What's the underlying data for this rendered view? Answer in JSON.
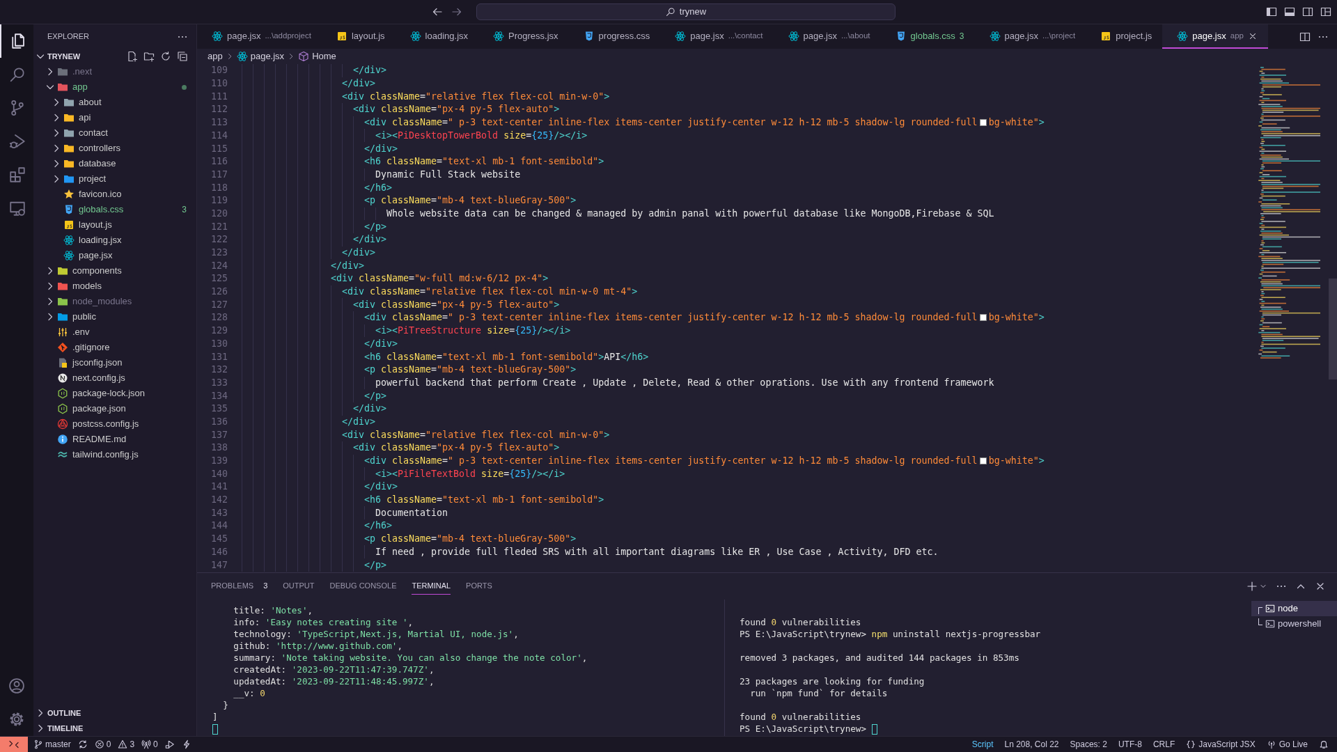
{
  "title_bar": {
    "search": "trynew"
  },
  "activity_bar": [
    {
      "kind": "files",
      "selected": true
    },
    {
      "kind": "search",
      "selected": false
    },
    {
      "kind": "source-control",
      "selected": false
    },
    {
      "kind": "run-debug",
      "selected": false
    },
    {
      "kind": "extensions",
      "selected": false
    },
    {
      "kind": "remote-explorer",
      "selected": false
    }
  ],
  "activity_bar_bottom": [
    {
      "kind": "account"
    },
    {
      "kind": "settings"
    }
  ],
  "sidebar": {
    "title": "EXPLORER",
    "root": {
      "label": "TRYNEW",
      "expanded": true
    },
    "tree": [
      {
        "label": ".next",
        "kind": "folder-next",
        "expanded": false,
        "modified": false,
        "ignored": true
      },
      {
        "label": "app",
        "kind": "folder-app",
        "expanded": true,
        "modified": true,
        "ignored": false,
        "children": [
          {
            "label": "about",
            "kind": "folder",
            "expanded": false,
            "modified": false,
            "ignored": false
          },
          {
            "label": "api",
            "kind": "folder-api",
            "expanded": false,
            "modified": false,
            "ignored": false
          },
          {
            "label": "contact",
            "kind": "folder",
            "expanded": false,
            "modified": false,
            "ignored": false
          },
          {
            "label": "controllers",
            "kind": "folder-controllers",
            "expanded": false,
            "modified": false,
            "ignored": false
          },
          {
            "label": "database",
            "kind": "folder-database",
            "expanded": false,
            "modified": false,
            "ignored": false
          },
          {
            "label": "project",
            "kind": "folder-project",
            "expanded": false,
            "modified": false,
            "ignored": false
          },
          {
            "label": "favicon.ico",
            "kind": "star",
            "modified": false,
            "ignored": false
          },
          {
            "label": "globals.css",
            "kind": "css",
            "modified": true,
            "ignored": false,
            "badge": "3"
          },
          {
            "label": "layout.js",
            "kind": "js",
            "modified": false,
            "ignored": false
          },
          {
            "label": "loading.jsx",
            "kind": "react",
            "modified": false,
            "ignored": false
          },
          {
            "label": "page.jsx",
            "kind": "react",
            "modified": false,
            "ignored": false
          }
        ]
      },
      {
        "label": "components",
        "kind": "folder-components",
        "expanded": false,
        "modified": false,
        "ignored": false
      },
      {
        "label": "models",
        "kind": "folder-models",
        "expanded": false,
        "modified": false,
        "ignored": false
      },
      {
        "label": "node_modules",
        "kind": "folder-node",
        "expanded": false,
        "modified": false,
        "ignored": true
      },
      {
        "label": "public",
        "kind": "folder-public",
        "expanded": false,
        "modified": false,
        "ignored": false
      },
      {
        "label": ".env",
        "kind": "env",
        "modified": false,
        "ignored": false
      },
      {
        "label": ".gitignore",
        "kind": "git",
        "modified": false,
        "ignored": false
      },
      {
        "label": "jsconfig.json",
        "kind": "jsconfig",
        "modified": false,
        "ignored": false
      },
      {
        "label": "next.config.js",
        "kind": "next",
        "modified": false,
        "ignored": false
      },
      {
        "label": "package-lock.json",
        "kind": "nodejs",
        "modified": false,
        "ignored": false
      },
      {
        "label": "package.json",
        "kind": "nodejs",
        "modified": false,
        "ignored": false
      },
      {
        "label": "postcss.config.js",
        "kind": "postcss",
        "modified": false,
        "ignored": false
      },
      {
        "label": "README.md",
        "kind": "info",
        "modified": false,
        "ignored": false
      },
      {
        "label": "tailwind.config.js",
        "kind": "tailwind",
        "modified": false,
        "ignored": false
      }
    ],
    "sections": [
      {
        "label": "OUTLINE",
        "expanded": false
      },
      {
        "label": "TIMELINE",
        "expanded": false
      }
    ]
  },
  "tabs": [
    {
      "label": "page.jsx",
      "description": "...\\addproject",
      "kind": "react",
      "selected": false,
      "modified": false
    },
    {
      "label": "layout.js",
      "kind": "js",
      "selected": false,
      "modified": false
    },
    {
      "label": "loading.jsx",
      "kind": "react",
      "selected": false,
      "modified": false
    },
    {
      "label": "Progress.jsx",
      "kind": "react",
      "selected": false,
      "modified": false
    },
    {
      "label": "progress.css",
      "kind": "css",
      "selected": false,
      "modified": false
    },
    {
      "label": "page.jsx",
      "description": "...\\contact",
      "kind": "react",
      "selected": false,
      "modified": false
    },
    {
      "label": "page.jsx",
      "description": "...\\about",
      "kind": "react",
      "selected": false,
      "modified": false
    },
    {
      "label": "globals.css",
      "kind": "css",
      "selected": false,
      "modified": true,
      "badge": "3"
    },
    {
      "label": "page.jsx",
      "description": "...\\project",
      "kind": "react",
      "selected": false,
      "modified": false
    },
    {
      "label": "project.js",
      "kind": "js",
      "selected": false,
      "modified": false
    },
    {
      "label": "page.jsx",
      "description": "app",
      "kind": "react",
      "selected": true,
      "modified": false
    }
  ],
  "breadcrumbs": [
    {
      "label": "app"
    },
    {
      "label": "page.jsx",
      "kind": "react"
    },
    {
      "label": "Home",
      "kind": "symbol"
    }
  ],
  "editor": {
    "lines": [
      {
        "number": "109",
        "tokens": [
          {
            "kind": "tag",
            "text": "                    </div>"
          }
        ]
      },
      {
        "number": "110",
        "tokens": [
          {
            "kind": "tag",
            "text": "                  </div>"
          }
        ]
      },
      {
        "number": "111",
        "tokens": [
          {
            "kind": "tag",
            "text": "                  <div"
          },
          {
            "kind": "attr",
            "text": " className"
          },
          {
            "kind": "op",
            "text": "="
          },
          {
            "kind": "str",
            "text": "\"relative flex flex-col min-w-0\""
          },
          {
            "kind": "tag",
            "text": ">"
          }
        ]
      },
      {
        "number": "112",
        "tokens": [
          {
            "kind": "tag",
            "text": "                    <div"
          },
          {
            "kind": "attr",
            "text": " className"
          },
          {
            "kind": "op",
            "text": "="
          },
          {
            "kind": "str",
            "text": "\"px-4 py-5 flex-auto\""
          },
          {
            "kind": "tag",
            "text": ">"
          }
        ]
      },
      {
        "number": "113",
        "tokens": [
          {
            "kind": "tag",
            "text": "                      <div"
          },
          {
            "kind": "attr",
            "text": " className"
          },
          {
            "kind": "op",
            "text": "="
          },
          {
            "kind": "str",
            "text": "\" p-3 text-center inline-flex items-center justify-center w-12 h-12 mb-5 shadow-lg rounded-full"
          },
          {
            "kind": "swatch",
            "color": "#ffffff"
          },
          {
            "kind": "str",
            "text": "bg-white\""
          },
          {
            "kind": "tag",
            "text": ">"
          }
        ]
      },
      {
        "number": "114",
        "tokens": [
          {
            "kind": "tag",
            "text": "                        <i><"
          },
          {
            "kind": "comp",
            "text": "PiDesktopTowerBold"
          },
          {
            "kind": "attr",
            "text": " size"
          },
          {
            "kind": "op",
            "text": "="
          },
          {
            "kind": "num",
            "text": "{25}"
          },
          {
            "kind": "tag",
            "text": "/></i>"
          }
        ]
      },
      {
        "number": "115",
        "tokens": [
          {
            "kind": "tag",
            "text": "                      </div>"
          }
        ]
      },
      {
        "number": "116",
        "tokens": [
          {
            "kind": "tag",
            "text": "                      <h6"
          },
          {
            "kind": "attr",
            "text": " className"
          },
          {
            "kind": "op",
            "text": "="
          },
          {
            "kind": "str",
            "text": "\"text-xl mb-1 font-semibold\""
          },
          {
            "kind": "tag",
            "text": ">"
          }
        ]
      },
      {
        "number": "117",
        "tokens": [
          {
            "kind": "txt",
            "text": "                        Dynamic Full Stack website"
          }
        ]
      },
      {
        "number": "118",
        "tokens": [
          {
            "kind": "tag",
            "text": "                      </h6>"
          }
        ]
      },
      {
        "number": "119",
        "tokens": [
          {
            "kind": "tag",
            "text": "                      <p"
          },
          {
            "kind": "attr",
            "text": " className"
          },
          {
            "kind": "op",
            "text": "="
          },
          {
            "kind": "str",
            "text": "\"mb-4 text-blueGray-500\""
          },
          {
            "kind": "tag",
            "text": ">"
          }
        ]
      },
      {
        "number": "120",
        "tokens": [
          {
            "kind": "txt",
            "text": "                          Whole website data can be changed & managed by admin panal with powerful database like MongoDB,Firebase & SQL"
          }
        ]
      },
      {
        "number": "121",
        "tokens": [
          {
            "kind": "tag",
            "text": "                      </p>"
          }
        ]
      },
      {
        "number": "122",
        "tokens": [
          {
            "kind": "tag",
            "text": "                    </div>"
          }
        ]
      },
      {
        "number": "123",
        "tokens": [
          {
            "kind": "tag",
            "text": "                  </div>"
          }
        ]
      },
      {
        "number": "124",
        "tokens": [
          {
            "kind": "tag",
            "text": "                </div>"
          }
        ]
      },
      {
        "number": "125",
        "tokens": [
          {
            "kind": "tag",
            "text": "                <div"
          },
          {
            "kind": "attr",
            "text": " className"
          },
          {
            "kind": "op",
            "text": "="
          },
          {
            "kind": "str",
            "text": "\"w-full md:w-6/12 px-4\""
          },
          {
            "kind": "tag",
            "text": ">"
          }
        ]
      },
      {
        "number": "126",
        "tokens": [
          {
            "kind": "tag",
            "text": "                  <div"
          },
          {
            "kind": "attr",
            "text": " className"
          },
          {
            "kind": "op",
            "text": "="
          },
          {
            "kind": "str",
            "text": "\"relative flex flex-col min-w-0 mt-4\""
          },
          {
            "kind": "tag",
            "text": ">"
          }
        ]
      },
      {
        "number": "127",
        "tokens": [
          {
            "kind": "tag",
            "text": "                    <div"
          },
          {
            "kind": "attr",
            "text": " className"
          },
          {
            "kind": "op",
            "text": "="
          },
          {
            "kind": "str",
            "text": "\"px-4 py-5 flex-auto\""
          },
          {
            "kind": "tag",
            "text": ">"
          }
        ]
      },
      {
        "number": "128",
        "tokens": [
          {
            "kind": "tag",
            "text": "                      <div"
          },
          {
            "kind": "attr",
            "text": " className"
          },
          {
            "kind": "op",
            "text": "="
          },
          {
            "kind": "str",
            "text": "\" p-3 text-center inline-flex items-center justify-center w-12 h-12 mb-5 shadow-lg rounded-full"
          },
          {
            "kind": "swatch",
            "color": "#ffffff"
          },
          {
            "kind": "str",
            "text": "bg-white\""
          },
          {
            "kind": "tag",
            "text": ">"
          }
        ]
      },
      {
        "number": "129",
        "tokens": [
          {
            "kind": "tag",
            "text": "                        <i><"
          },
          {
            "kind": "comp",
            "text": "PiTreeStructure"
          },
          {
            "kind": "attr",
            "text": " size"
          },
          {
            "kind": "op",
            "text": "="
          },
          {
            "kind": "num",
            "text": "{25}"
          },
          {
            "kind": "tag",
            "text": "/></i>"
          }
        ]
      },
      {
        "number": "130",
        "tokens": [
          {
            "kind": "tag",
            "text": "                      </div>"
          }
        ]
      },
      {
        "number": "131",
        "tokens": [
          {
            "kind": "tag",
            "text": "                      <h6"
          },
          {
            "kind": "attr",
            "text": " className"
          },
          {
            "kind": "op",
            "text": "="
          },
          {
            "kind": "str",
            "text": "\"text-xl mb-1 font-semibold\""
          },
          {
            "kind": "tag",
            "text": ">"
          },
          {
            "kind": "txt",
            "text": "API"
          },
          {
            "kind": "tag",
            "text": "</h6>"
          }
        ]
      },
      {
        "number": "132",
        "tokens": [
          {
            "kind": "tag",
            "text": "                      <p"
          },
          {
            "kind": "attr",
            "text": " className"
          },
          {
            "kind": "op",
            "text": "="
          },
          {
            "kind": "str",
            "text": "\"mb-4 text-blueGray-500\""
          },
          {
            "kind": "tag",
            "text": ">"
          }
        ]
      },
      {
        "number": "133",
        "tokens": [
          {
            "kind": "txt",
            "text": "                        powerful backend that perform Create , Update , Delete, Read & other oprations. Use with any frontend framework"
          }
        ]
      },
      {
        "number": "134",
        "tokens": [
          {
            "kind": "tag",
            "text": "                      </p>"
          }
        ]
      },
      {
        "number": "135",
        "tokens": [
          {
            "kind": "tag",
            "text": "                    </div>"
          }
        ]
      },
      {
        "number": "136",
        "tokens": [
          {
            "kind": "tag",
            "text": "                  </div>"
          }
        ]
      },
      {
        "number": "137",
        "tokens": [
          {
            "kind": "tag",
            "text": "                  <div"
          },
          {
            "kind": "attr",
            "text": " className"
          },
          {
            "kind": "op",
            "text": "="
          },
          {
            "kind": "str",
            "text": "\"relative flex flex-col min-w-0\""
          },
          {
            "kind": "tag",
            "text": ">"
          }
        ]
      },
      {
        "number": "138",
        "tokens": [
          {
            "kind": "tag",
            "text": "                    <div"
          },
          {
            "kind": "attr",
            "text": " className"
          },
          {
            "kind": "op",
            "text": "="
          },
          {
            "kind": "str",
            "text": "\"px-4 py-5 flex-auto\""
          },
          {
            "kind": "tag",
            "text": ">"
          }
        ]
      },
      {
        "number": "139",
        "tokens": [
          {
            "kind": "tag",
            "text": "                      <div"
          },
          {
            "kind": "attr",
            "text": " className"
          },
          {
            "kind": "op",
            "text": "="
          },
          {
            "kind": "str",
            "text": "\" p-3 text-center inline-flex items-center justify-center w-12 h-12 mb-5 shadow-lg rounded-full"
          },
          {
            "kind": "swatch",
            "color": "#ffffff"
          },
          {
            "kind": "str",
            "text": "bg-white\""
          },
          {
            "kind": "tag",
            "text": ">"
          }
        ]
      },
      {
        "number": "140",
        "tokens": [
          {
            "kind": "tag",
            "text": "                        <i><"
          },
          {
            "kind": "comp",
            "text": "PiFileTextBold"
          },
          {
            "kind": "attr",
            "text": " size"
          },
          {
            "kind": "op",
            "text": "="
          },
          {
            "kind": "num",
            "text": "{25}"
          },
          {
            "kind": "tag",
            "text": "/></i>"
          }
        ]
      },
      {
        "number": "141",
        "tokens": [
          {
            "kind": "tag",
            "text": "                      </div>"
          }
        ]
      },
      {
        "number": "142",
        "tokens": [
          {
            "kind": "tag",
            "text": "                      <h6"
          },
          {
            "kind": "attr",
            "text": " className"
          },
          {
            "kind": "op",
            "text": "="
          },
          {
            "kind": "str",
            "text": "\"text-xl mb-1 font-semibold\""
          },
          {
            "kind": "tag",
            "text": ">"
          }
        ]
      },
      {
        "number": "143",
        "tokens": [
          {
            "kind": "txt",
            "text": "                        Documentation"
          }
        ]
      },
      {
        "number": "144",
        "tokens": [
          {
            "kind": "tag",
            "text": "                      </h6>"
          }
        ]
      },
      {
        "number": "145",
        "tokens": [
          {
            "kind": "tag",
            "text": "                      <p"
          },
          {
            "kind": "attr",
            "text": " className"
          },
          {
            "kind": "op",
            "text": "="
          },
          {
            "kind": "str",
            "text": "\"mb-4 text-blueGray-500\""
          },
          {
            "kind": "tag",
            "text": ">"
          }
        ]
      },
      {
        "number": "146",
        "tokens": [
          {
            "kind": "txt",
            "text": "                        If need , provide full fleded SRS with all important diagrams like ER , Use Case , Activity, DFD etc."
          }
        ]
      },
      {
        "number": "147",
        "tokens": [
          {
            "kind": "tag",
            "text": "                      </p>"
          }
        ]
      }
    ]
  },
  "panel": {
    "tabs": [
      {
        "label": "PROBLEMS",
        "badge": "3",
        "selected": false
      },
      {
        "label": "OUTPUT",
        "selected": false
      },
      {
        "label": "DEBUG CONSOLE",
        "selected": false
      },
      {
        "label": "TERMINAL",
        "selected": true
      },
      {
        "label": "PORTS",
        "selected": false
      }
    ],
    "terminal_left": [
      {
        "tokens": [
          {
            "kind": "txt",
            "text": "    title: "
          },
          {
            "kind": "str",
            "text": "'Notes'"
          },
          {
            "kind": "txt",
            "text": ","
          }
        ]
      },
      {
        "tokens": [
          {
            "kind": "txt",
            "text": "    info: "
          },
          {
            "kind": "str",
            "text": "'Easy notes creating site '"
          },
          {
            "kind": "txt",
            "text": ","
          }
        ]
      },
      {
        "tokens": [
          {
            "kind": "txt",
            "text": "    technology: "
          },
          {
            "kind": "str",
            "text": "'TypeScript,Next.js, Martial UI, node.js'"
          },
          {
            "kind": "txt",
            "text": ","
          }
        ]
      },
      {
        "tokens": [
          {
            "kind": "txt",
            "text": "    github: "
          },
          {
            "kind": "str",
            "text": "'http://www.github.com'"
          },
          {
            "kind": "txt",
            "text": ","
          }
        ]
      },
      {
        "tokens": [
          {
            "kind": "txt",
            "text": "    summary: "
          },
          {
            "kind": "str",
            "text": "'Note taking website. You can also change the note color'"
          },
          {
            "kind": "txt",
            "text": ","
          }
        ]
      },
      {
        "tokens": [
          {
            "kind": "txt",
            "text": "    createdAt: "
          },
          {
            "kind": "str",
            "text": "'2023-09-22T11:47:39.747Z'"
          },
          {
            "kind": "txt",
            "text": ","
          }
        ]
      },
      {
        "tokens": [
          {
            "kind": "txt",
            "text": "    updatedAt: "
          },
          {
            "kind": "str",
            "text": "'2023-09-22T11:48:45.997Z'"
          },
          {
            "kind": "txt",
            "text": ","
          }
        ]
      },
      {
        "tokens": [
          {
            "kind": "txt",
            "text": "    __v: "
          },
          {
            "kind": "num",
            "text": "0"
          }
        ]
      },
      {
        "tokens": [
          {
            "kind": "txt",
            "text": "  }"
          }
        ]
      },
      {
        "tokens": [
          {
            "kind": "txt",
            "text": "]"
          }
        ]
      },
      {
        "cursor": true
      }
    ],
    "terminal_right": [
      {
        "lines": [
          {
            "tokens": [
              {
                "kind": "txt",
                "text": "found "
              },
              {
                "kind": "num",
                "text": "0"
              },
              {
                "kind": "txt",
                "text": " vulnerabilities"
              }
            ]
          },
          {
            "tokens": [
              {
                "kind": "txt",
                "text": "PS E:\\JavaScript\\trynew> "
              },
              {
                "kind": "cmd",
                "text": "npm"
              },
              {
                "kind": "txt",
                "text": " uninstall nextjs-progressbar"
              }
            ]
          }
        ]
      },
      {
        "lines": [
          {
            "tokens": [
              {
                "kind": "txt",
                "text": "removed 3 packages, and audited 144 packages in 853ms"
              }
            ]
          }
        ]
      },
      {
        "lines": [
          {
            "tokens": [
              {
                "kind": "txt",
                "text": "23 packages are looking for funding"
              }
            ]
          },
          {
            "tokens": [
              {
                "kind": "txt",
                "text": "  run `npm fund` for details"
              }
            ]
          }
        ]
      },
      {
        "lines": [
          {
            "tokens": [
              {
                "kind": "txt",
                "text": "found "
              },
              {
                "kind": "num",
                "text": "0"
              },
              {
                "kind": "txt",
                "text": " vulnerabilities"
              }
            ]
          },
          {
            "tokens": [
              {
                "kind": "txt",
                "text": "PS E:\\JavaScript\\trynew> "
              }
            ],
            "cursor": true
          }
        ]
      }
    ],
    "terminals": [
      {
        "label": "node",
        "selected": true
      },
      {
        "label": "powershell",
        "selected": false
      }
    ]
  },
  "status_bar": {
    "left": [
      {
        "kind": "branch",
        "text": "master"
      },
      {
        "kind": "sync"
      },
      {
        "kind": "error",
        "text": "0"
      },
      {
        "kind": "warning",
        "text": "3"
      },
      {
        "kind": "ports",
        "text": "0"
      },
      {
        "kind": "run"
      },
      {
        "kind": "lightning"
      }
    ],
    "right": [
      {
        "kind": "language-mode",
        "text": "Script"
      },
      {
        "kind": "text",
        "text": "Ln 208, Col 22"
      },
      {
        "kind": "text",
        "text": "Spaces: 2"
      },
      {
        "kind": "text",
        "text": "UTF-8"
      },
      {
        "kind": "text",
        "text": "CRLF"
      },
      {
        "kind": "braces",
        "text": "JavaScript JSX"
      },
      {
        "kind": "broadcast",
        "text": "Go Live"
      },
      {
        "kind": "bell"
      }
    ]
  }
}
